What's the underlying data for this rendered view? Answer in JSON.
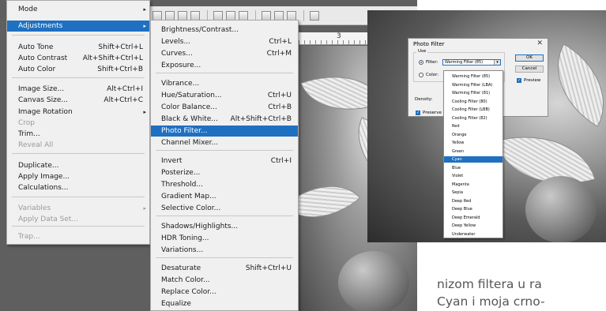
{
  "menu": {
    "items": [
      {
        "label": "Mode",
        "shortcut": "",
        "submenu": true,
        "disabled": false,
        "highlight": false
      },
      {
        "label": "Adjustments",
        "shortcut": "",
        "submenu": true,
        "disabled": false,
        "highlight": true
      },
      {
        "label": "Auto Tone",
        "shortcut": "Shift+Ctrl+L",
        "submenu": false,
        "disabled": false,
        "highlight": false
      },
      {
        "label": "Auto Contrast",
        "shortcut": "Alt+Shift+Ctrl+L",
        "submenu": false,
        "disabled": false,
        "highlight": false
      },
      {
        "label": "Auto Color",
        "shortcut": "Shift+Ctrl+B",
        "submenu": false,
        "disabled": false,
        "highlight": false
      },
      {
        "label": "Image Size...",
        "shortcut": "Alt+Ctrl+I",
        "submenu": false,
        "disabled": false,
        "highlight": false
      },
      {
        "label": "Canvas Size...",
        "shortcut": "Alt+Ctrl+C",
        "submenu": false,
        "disabled": false,
        "highlight": false
      },
      {
        "label": "Image Rotation",
        "shortcut": "",
        "submenu": true,
        "disabled": false,
        "highlight": false
      },
      {
        "label": "Crop",
        "shortcut": "",
        "submenu": false,
        "disabled": true,
        "highlight": false
      },
      {
        "label": "Trim...",
        "shortcut": "",
        "submenu": false,
        "disabled": false,
        "highlight": false
      },
      {
        "label": "Reveal All",
        "shortcut": "",
        "submenu": false,
        "disabled": true,
        "highlight": false
      },
      {
        "label": "Duplicate...",
        "shortcut": "",
        "submenu": false,
        "disabled": false,
        "highlight": false
      },
      {
        "label": "Apply Image...",
        "shortcut": "",
        "submenu": false,
        "disabled": false,
        "highlight": false
      },
      {
        "label": "Calculations...",
        "shortcut": "",
        "submenu": false,
        "disabled": false,
        "highlight": false
      },
      {
        "label": "Variables",
        "shortcut": "",
        "submenu": true,
        "disabled": true,
        "highlight": false
      },
      {
        "label": "Apply Data Set...",
        "shortcut": "",
        "submenu": false,
        "disabled": true,
        "highlight": false
      },
      {
        "label": "Trap...",
        "shortcut": "",
        "submenu": false,
        "disabled": true,
        "highlight": false
      }
    ]
  },
  "submenu": {
    "items": [
      {
        "label": "Brightness/Contrast...",
        "shortcut": "",
        "highlight": false
      },
      {
        "label": "Levels...",
        "shortcut": "Ctrl+L",
        "highlight": false
      },
      {
        "label": "Curves...",
        "shortcut": "Ctrl+M",
        "highlight": false
      },
      {
        "label": "Exposure...",
        "shortcut": "",
        "highlight": false
      },
      {
        "label": "Vibrance...",
        "shortcut": "",
        "highlight": false
      },
      {
        "label": "Hue/Saturation...",
        "shortcut": "Ctrl+U",
        "highlight": false
      },
      {
        "label": "Color Balance...",
        "shortcut": "Ctrl+B",
        "highlight": false
      },
      {
        "label": "Black & White...",
        "shortcut": "Alt+Shift+Ctrl+B",
        "highlight": false
      },
      {
        "label": "Photo Filter...",
        "shortcut": "",
        "highlight": true
      },
      {
        "label": "Channel Mixer...",
        "shortcut": "",
        "highlight": false
      },
      {
        "label": "Invert",
        "shortcut": "Ctrl+I",
        "highlight": false
      },
      {
        "label": "Posterize...",
        "shortcut": "",
        "highlight": false
      },
      {
        "label": "Threshold...",
        "shortcut": "",
        "highlight": false
      },
      {
        "label": "Gradient Map...",
        "shortcut": "",
        "highlight": false
      },
      {
        "label": "Selective Color...",
        "shortcut": "",
        "highlight": false
      },
      {
        "label": "Shadows/Highlights...",
        "shortcut": "",
        "highlight": false
      },
      {
        "label": "HDR Toning...",
        "shortcut": "",
        "highlight": false
      },
      {
        "label": "Variations...",
        "shortcut": "",
        "highlight": false
      },
      {
        "label": "Desaturate",
        "shortcut": "Shift+Ctrl+U",
        "highlight": false
      },
      {
        "label": "Match Color...",
        "shortcut": "",
        "highlight": false
      },
      {
        "label": "Replace Color...",
        "shortcut": "",
        "highlight": false
      },
      {
        "label": "Equalize",
        "shortcut": "",
        "highlight": false
      }
    ]
  },
  "ruler": {
    "label": "3"
  },
  "dialog": {
    "title": "Photo Filter",
    "close": "✕",
    "use_label": "Use",
    "filter_label": "Filter:",
    "color_label": "Color:",
    "selected_filter": "Warming Filter (85)",
    "density_label": "Density:",
    "preserve_label": "Preserve",
    "ok_label": "OK",
    "cancel_label": "Cancel",
    "preview_label": "Preview",
    "options": [
      "Warming Filter (85)",
      "Warming Filter (LBA)",
      "Warming Filter (81)",
      "Cooling Filter (80)",
      "Cooling Filter (LBB)",
      "Cooling Filter (82)",
      "Red",
      "Orange",
      "Yellow",
      "Green",
      "Cyan",
      "Blue",
      "Violet",
      "Magenta",
      "Sepia",
      "Deep Red",
      "Deep Blue",
      "Deep Emerald",
      "Deep Yellow",
      "Underwater"
    ],
    "highlighted_option": "Cyan"
  },
  "article": {
    "line1": "nizom filtera u ra",
    "line2": "Cyan i moja crno-"
  },
  "colors": {
    "highlight": "#1f70c1",
    "menu_bg": "#f0f0f0",
    "disabled": "#9a9a9a"
  }
}
